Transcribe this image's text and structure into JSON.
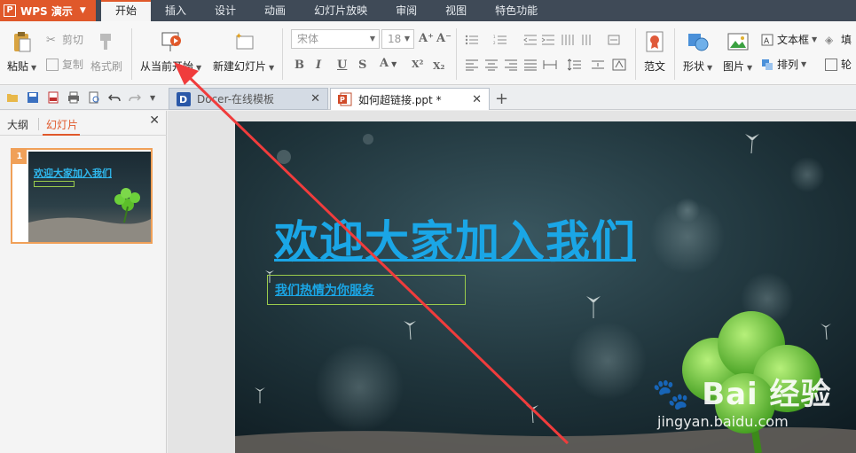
{
  "app": {
    "name": "WPS 演示",
    "logo": "P",
    "accent": "#e0582a"
  },
  "menu": {
    "tabs": [
      "开始",
      "插入",
      "设计",
      "动画",
      "幻灯片放映",
      "审阅",
      "视图",
      "特色功能"
    ]
  },
  "ribbon": {
    "paste": "粘贴",
    "cut": "剪切",
    "copy": "复制",
    "format_painter": "格式刷",
    "from_current": "从当前开始",
    "new_slide": "新建幻灯片",
    "font_name": "宋体",
    "font_size": "18",
    "template": "范文",
    "shape": "形状",
    "picture": "图片",
    "textbox": "文本框",
    "arrange": "排列",
    "fill": "填",
    "outline": "轮"
  },
  "doc_tabs": [
    {
      "label": "Docer-在线模板"
    },
    {
      "label": "如何超链接.ppt *"
    }
  ],
  "panel": {
    "tab_outline": "大纲",
    "tab_slides": "幻灯片",
    "slide_number": "1",
    "thumb_title": "欢迎大家加入我们"
  },
  "slide": {
    "title": "欢迎大家加入我们",
    "subtitle": "我们热情为你服务",
    "title_color": "#1aa6e6"
  },
  "watermark": {
    "main": "Bai 经验",
    "url": "jingyan.baidu.com"
  }
}
